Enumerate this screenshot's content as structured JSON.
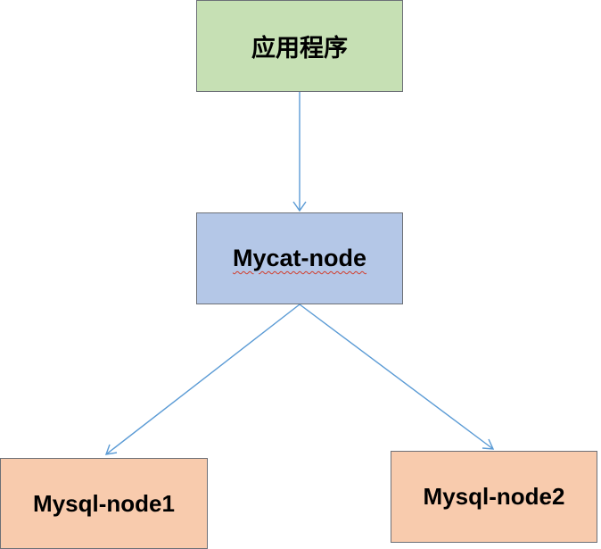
{
  "nodes": {
    "app": {
      "label": "应用程序",
      "fill": "#c6e0b4"
    },
    "mycat": {
      "label": "Mycat-node",
      "fill": "#b4c7e7"
    },
    "mysql1": {
      "label": "Mysql-node1",
      "fill": "#f8cbad"
    },
    "mysql2": {
      "label": "Mysql-node2",
      "fill": "#f8cbad"
    }
  },
  "edges": [
    {
      "from": "app",
      "to": "mycat"
    },
    {
      "from": "mycat",
      "to": "mysql1"
    },
    {
      "from": "mycat",
      "to": "mysql2"
    }
  ],
  "colors": {
    "edge": "#5b9bd5",
    "border": "#6d7077",
    "spellcheck_underline": "#d23b2a"
  }
}
